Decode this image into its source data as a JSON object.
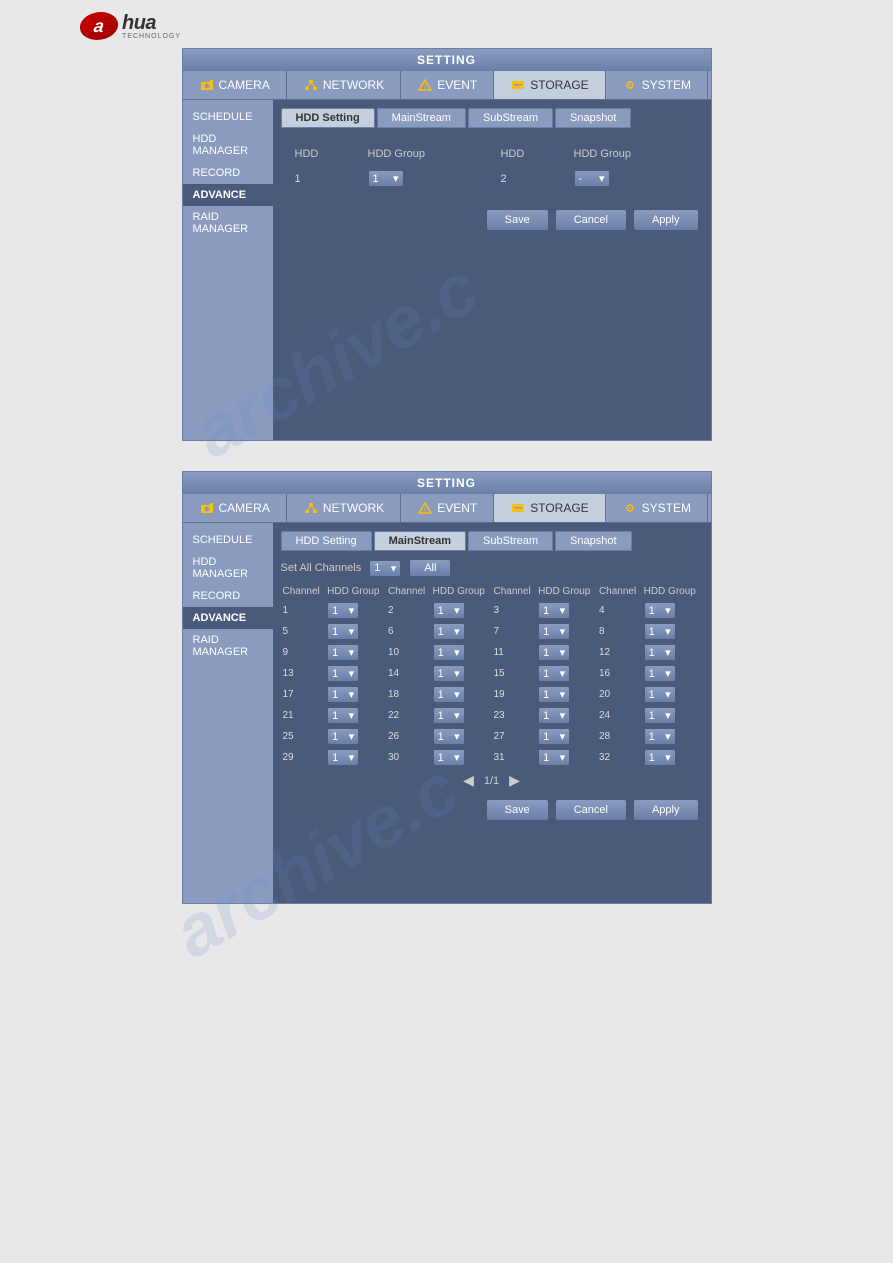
{
  "page": {
    "watermark1": "archive.c",
    "watermark2": "archive.c"
  },
  "logo": {
    "a": "a",
    "hua": "hua",
    "tech": "TECHNOLOGY"
  },
  "panel1": {
    "title": "SETTING",
    "topnav": [
      {
        "id": "camera",
        "label": "CAMERA",
        "icon": "camera"
      },
      {
        "id": "network",
        "label": "NETWORK",
        "icon": "network"
      },
      {
        "id": "event",
        "label": "EVENT",
        "icon": "event"
      },
      {
        "id": "storage",
        "label": "STORAGE",
        "icon": "storage",
        "active": true
      },
      {
        "id": "system",
        "label": "SYSTEM",
        "icon": "system"
      }
    ],
    "sidebar": [
      {
        "id": "schedule",
        "label": "SCHEDULE"
      },
      {
        "id": "hdd-manager",
        "label": "HDD MANAGER"
      },
      {
        "id": "record",
        "label": "RECORD"
      },
      {
        "id": "advance",
        "label": "ADVANCE",
        "active": true
      },
      {
        "id": "raid-manager",
        "label": "RAID MANAGER"
      }
    ],
    "subtabs": [
      {
        "id": "hdd-setting",
        "label": "HDD Setting",
        "active": true
      },
      {
        "id": "mainstream",
        "label": "MainStream"
      },
      {
        "id": "substream",
        "label": "SubStream"
      },
      {
        "id": "snapshot",
        "label": "Snapshot"
      }
    ],
    "table": {
      "headers": [
        "HDD",
        "HDD Group",
        "HDD",
        "HDD Group"
      ],
      "rows": [
        {
          "hdd1": "1",
          "group1": "1",
          "hdd2": "2",
          "group2": "-"
        }
      ]
    },
    "buttons": {
      "save": "Save",
      "cancel": "Cancel",
      "apply": "Apply"
    }
  },
  "panel2": {
    "title": "SETTING",
    "topnav": [
      {
        "id": "camera",
        "label": "CAMERA",
        "icon": "camera"
      },
      {
        "id": "network",
        "label": "NETWORK",
        "icon": "network"
      },
      {
        "id": "event",
        "label": "EVENT",
        "icon": "event"
      },
      {
        "id": "storage",
        "label": "STORAGE",
        "icon": "storage",
        "active": true
      },
      {
        "id": "system",
        "label": "SYSTEM",
        "icon": "system"
      }
    ],
    "sidebar": [
      {
        "id": "schedule",
        "label": "SCHEDULE"
      },
      {
        "id": "hdd-manager",
        "label": "HDD MANAGER"
      },
      {
        "id": "record",
        "label": "RECORD"
      },
      {
        "id": "advance",
        "label": "ADVANCE",
        "active": true
      },
      {
        "id": "raid-manager",
        "label": "RAID MANAGER"
      }
    ],
    "subtabs": [
      {
        "id": "hdd-setting",
        "label": "HDD Setting"
      },
      {
        "id": "mainstream",
        "label": "MainStream",
        "active": true
      },
      {
        "id": "substream",
        "label": "SubStream"
      },
      {
        "id": "snapshot",
        "label": "Snapshot"
      }
    ],
    "set_all_label": "Set All Channels",
    "set_all_value": "1",
    "all_btn": "All",
    "col_headers": [
      "Channel",
      "HDD Group",
      "Channel",
      "HDD Group",
      "Channel",
      "HDD Group",
      "Channel",
      "HDD Group"
    ],
    "rows": [
      [
        {
          "ch": "1",
          "val": "1"
        },
        {
          "ch": "2",
          "val": "1"
        },
        {
          "ch": "3",
          "val": "1"
        },
        {
          "ch": "4",
          "val": "1"
        }
      ],
      [
        {
          "ch": "5",
          "val": "1"
        },
        {
          "ch": "6",
          "val": "1"
        },
        {
          "ch": "7",
          "val": "1"
        },
        {
          "ch": "8",
          "val": "1"
        }
      ],
      [
        {
          "ch": "9",
          "val": "1"
        },
        {
          "ch": "10",
          "val": "1"
        },
        {
          "ch": "11",
          "val": "1"
        },
        {
          "ch": "12",
          "val": "1"
        }
      ],
      [
        {
          "ch": "13",
          "val": "1"
        },
        {
          "ch": "14",
          "val": "1"
        },
        {
          "ch": "15",
          "val": "1"
        },
        {
          "ch": "16",
          "val": "1"
        }
      ],
      [
        {
          "ch": "17",
          "val": "1"
        },
        {
          "ch": "18",
          "val": "1"
        },
        {
          "ch": "19",
          "val": "1"
        },
        {
          "ch": "20",
          "val": "1"
        }
      ],
      [
        {
          "ch": "21",
          "val": "1"
        },
        {
          "ch": "22",
          "val": "1"
        },
        {
          "ch": "23",
          "val": "1"
        },
        {
          "ch": "24",
          "val": "1"
        }
      ],
      [
        {
          "ch": "25",
          "val": "1"
        },
        {
          "ch": "26",
          "val": "1"
        },
        {
          "ch": "27",
          "val": "1"
        },
        {
          "ch": "28",
          "val": "1"
        }
      ],
      [
        {
          "ch": "29",
          "val": "1"
        },
        {
          "ch": "30",
          "val": "1"
        },
        {
          "ch": "31",
          "val": "1"
        },
        {
          "ch": "32",
          "val": "1"
        }
      ]
    ],
    "pagination": "1/1",
    "buttons": {
      "save": "Save",
      "cancel": "Cancel",
      "apply": "Apply"
    }
  }
}
